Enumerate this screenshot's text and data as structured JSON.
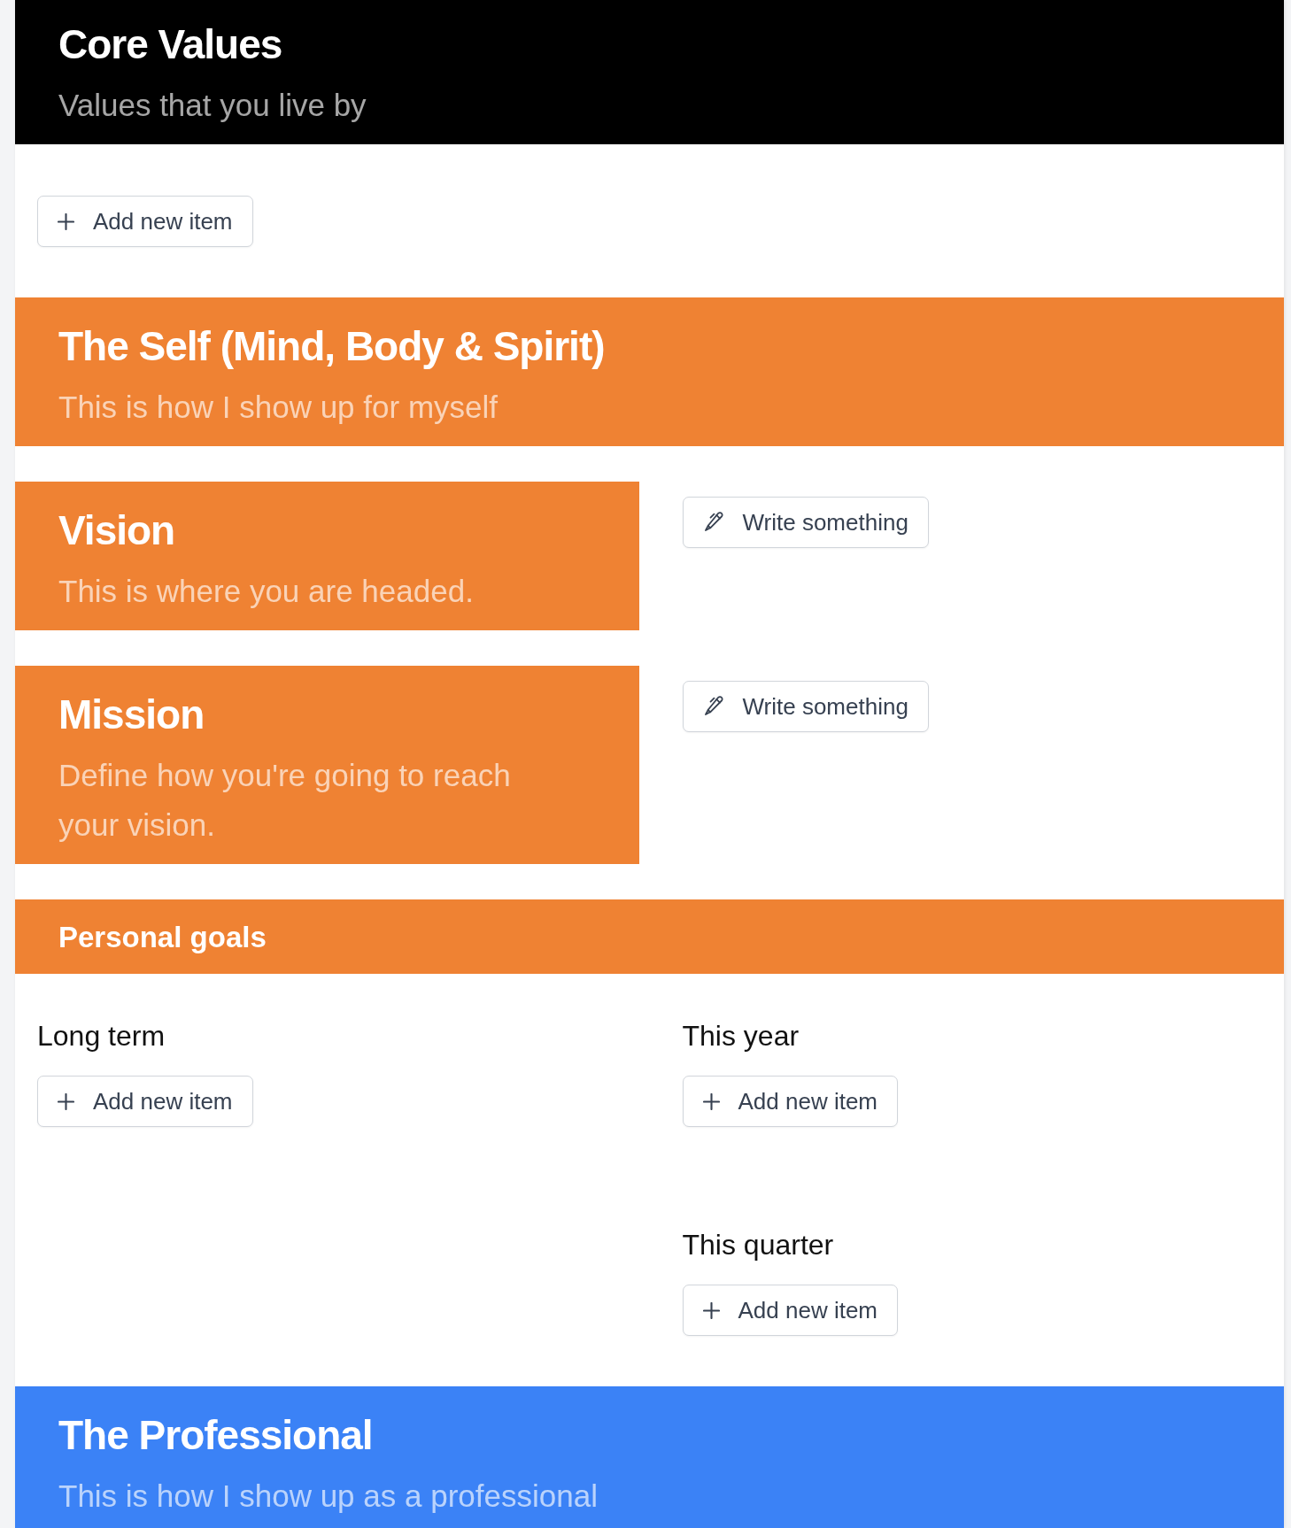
{
  "sections": [
    {
      "kind": "intro",
      "color": "#000000",
      "title": "Core Values",
      "subtitle": "Values that you live by",
      "add_button": "Add new item"
    },
    {
      "kind": "category",
      "color": "#ef8233",
      "title": "The Self (Mind, Body & Spirit)",
      "subtitle": "This is how I show up for myself",
      "statements": [
        {
          "title": "Vision",
          "subtitle": "This is where you are headed.",
          "button": "Write something"
        },
        {
          "title": "Mission",
          "subtitle": "Define how you're going to reach your vision.",
          "button": "Write something"
        }
      ],
      "goals": {
        "title": "Personal goals",
        "columns": [
          {
            "lists": [
              {
                "heading": "Long term",
                "button": "Add new item"
              }
            ]
          },
          {
            "lists": [
              {
                "heading": "This year",
                "button": "Add new item"
              },
              {
                "heading": "This quarter",
                "button": "Add new item"
              }
            ]
          }
        ]
      }
    },
    {
      "kind": "category",
      "color": "#3b82f6",
      "title": "The Professional",
      "subtitle": "This is how I show up as a professional"
    }
  ]
}
